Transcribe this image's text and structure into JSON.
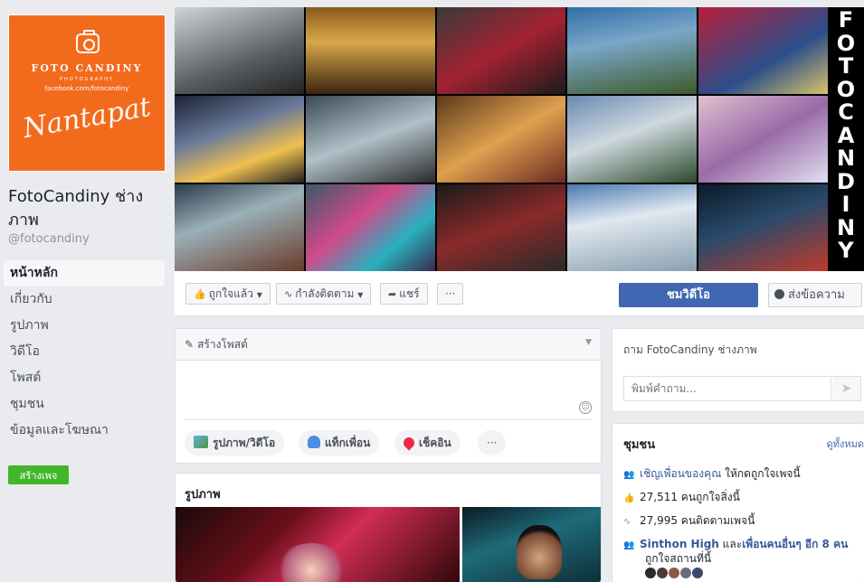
{
  "page": {
    "name": "FotoCandiny ช่างภาพ",
    "handle": "@fotocandiny",
    "create_page_label": "สร้างเพจ"
  },
  "profile_pic": {
    "brand": "FOTO CANDINY",
    "sub": "PHOTOGRAPHY",
    "facebook": "facebook.com/fotocandiny",
    "signature": "Nantapat",
    "bg_color": "#f26b1d",
    "icon": "camera-icon"
  },
  "nav": {
    "items": [
      {
        "label": "หน้าหลัก",
        "active": true
      },
      {
        "label": "เกี่ยวกับ"
      },
      {
        "label": "รูปภาพ"
      },
      {
        "label": "วิดีโอ"
      },
      {
        "label": "โพสต์"
      },
      {
        "label": "ชุมชน"
      },
      {
        "label": "ข้อมูลและโฆษณา"
      }
    ]
  },
  "cover": {
    "vertical_brand": "FOTOCANDINY"
  },
  "actions": {
    "like": "ถูกใจแล้ว",
    "follow": "กำลังติดตาม",
    "share": "แชร์",
    "more": "···",
    "watch_video": "ชมวิดีโอ",
    "send_message": "ส่งข้อความ"
  },
  "composer": {
    "title": "สร้างโพสต์",
    "photo_video": "รูปภาพ/วิดีโอ",
    "tag_friends": "แท็กเพื่อน",
    "check_in": "เช็คอิน",
    "more": "···"
  },
  "photos": {
    "title": "รูปภาพ"
  },
  "ask": {
    "title": "ถาม FotoCandiny ช่างภาพ",
    "placeholder": "พิมพ์คำถาม..."
  },
  "community": {
    "title": "ชุมชน",
    "see_all": "ดูทั้งหมด",
    "invite_link": "เชิญเพื่อนของคุณ",
    "invite_text": " ให้กดถูกใจเพจนี้",
    "likes": "27,511 คนถูกใจสิ่งนี้",
    "follows": "27,995 คนติดตามเพจนี้",
    "friend_link": "Sinthon High",
    "friend_mid": " และ",
    "others_link": "เพื่อนคนอื่นๆ อีก 8 คน",
    "friend_tail": "ถูกใจสถานที่นี้"
  },
  "colors": {
    "accent": "#4267b2",
    "green": "#42b72a",
    "bg": "#e9ebee"
  }
}
